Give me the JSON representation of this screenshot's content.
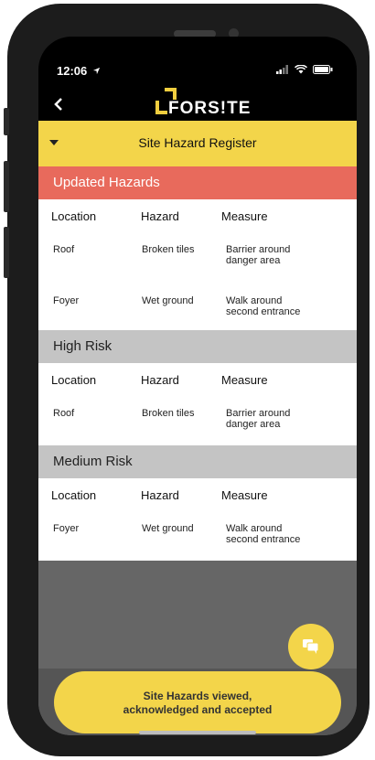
{
  "status_bar": {
    "time": "12:06"
  },
  "brand": {
    "logo_text": "FORS!TE"
  },
  "header": {
    "title": "Site Hazard Register"
  },
  "columns": [
    "Location",
    "Hazard",
    "Measure"
  ],
  "sections": {
    "updated": {
      "title": "Updated Hazards",
      "rows": [
        {
          "location": "Roof",
          "hazard": "Broken tiles",
          "measure_l1": "Barrier around",
          "measure_l2": "danger area"
        },
        {
          "location": "Foyer",
          "hazard": "Wet ground",
          "measure_l1": "Walk around",
          "measure_l2": "second entrance"
        }
      ]
    },
    "high": {
      "title": "High Risk",
      "rows": [
        {
          "location": "Roof",
          "hazard": "Broken tiles",
          "measure_l1": "Barrier around",
          "measure_l2": "danger area"
        }
      ]
    },
    "medium": {
      "title": "Medium Risk",
      "rows": [
        {
          "location": "Foyer",
          "hazard": "Wet ground",
          "measure_l1": "Walk around",
          "measure_l2": "second entrance"
        }
      ]
    }
  },
  "cta": {
    "line1": "Site Hazards viewed,",
    "line2": "acknowledged and accepted"
  },
  "icons": {
    "back": "chevron-left-icon",
    "chat": "chat-icon",
    "location_arrow": "location-arrow-icon"
  },
  "colors": {
    "accent": "#f3d54a",
    "updated": "#e86a5c",
    "section_grey": "#c4c4c4"
  }
}
